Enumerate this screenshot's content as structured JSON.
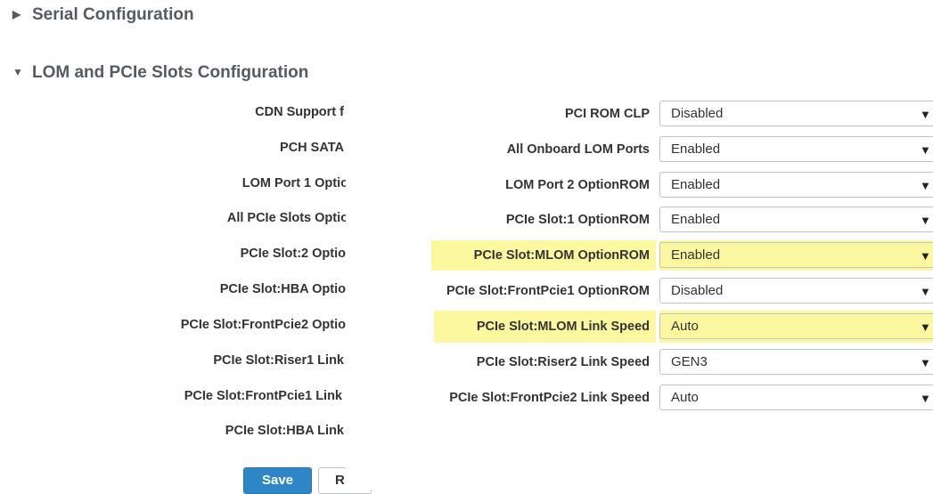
{
  "sections": {
    "serial": {
      "arrow": "▶",
      "title": "Serial Configuration"
    },
    "lom": {
      "arrow": "▼",
      "title": "LOM and PCIe Slots Configuration"
    }
  },
  "left_labels": [
    "CDN Support f",
    "PCH SATA",
    "LOM Port 1 Optio",
    "All PCIe Slots Optio",
    "PCIe Slot:2 Optio",
    "PCIe Slot:HBA Optio",
    "PCIe Slot:FrontPcie2 Optio",
    "PCIe Slot:Riser1 Link",
    "PCIe Slot:FrontPcie1 Link",
    "PCIe Slot:HBA Link"
  ],
  "settings": [
    {
      "label": "PCI ROM CLP",
      "value": "Disabled",
      "highlighted": false
    },
    {
      "label": "All Onboard LOM Ports",
      "value": "Enabled",
      "highlighted": false
    },
    {
      "label": "LOM Port 2 OptionROM",
      "value": "Enabled",
      "highlighted": false
    },
    {
      "label": "PCIe Slot:1 OptionROM",
      "value": "Enabled",
      "highlighted": false
    },
    {
      "label": "PCIe Slot:MLOM OptionROM",
      "value": "Enabled",
      "highlighted": true
    },
    {
      "label": "PCIe Slot:FrontPcie1 OptionROM",
      "value": "Disabled",
      "highlighted": false
    },
    {
      "label": "PCIe Slot:MLOM Link Speed",
      "value": "Auto",
      "highlighted": true
    },
    {
      "label": "PCIe Slot:Riser2 Link Speed",
      "value": "GEN3",
      "highlighted": false
    },
    {
      "label": "PCIe Slot:FrontPcie2 Link Speed",
      "value": "Auto",
      "highlighted": false
    }
  ],
  "dropdown_caret": "▼",
  "buttons": {
    "save": "Save",
    "reset": "R"
  },
  "colors": {
    "highlight": "#fbf8a0",
    "primary_button": "#2e86c7"
  }
}
